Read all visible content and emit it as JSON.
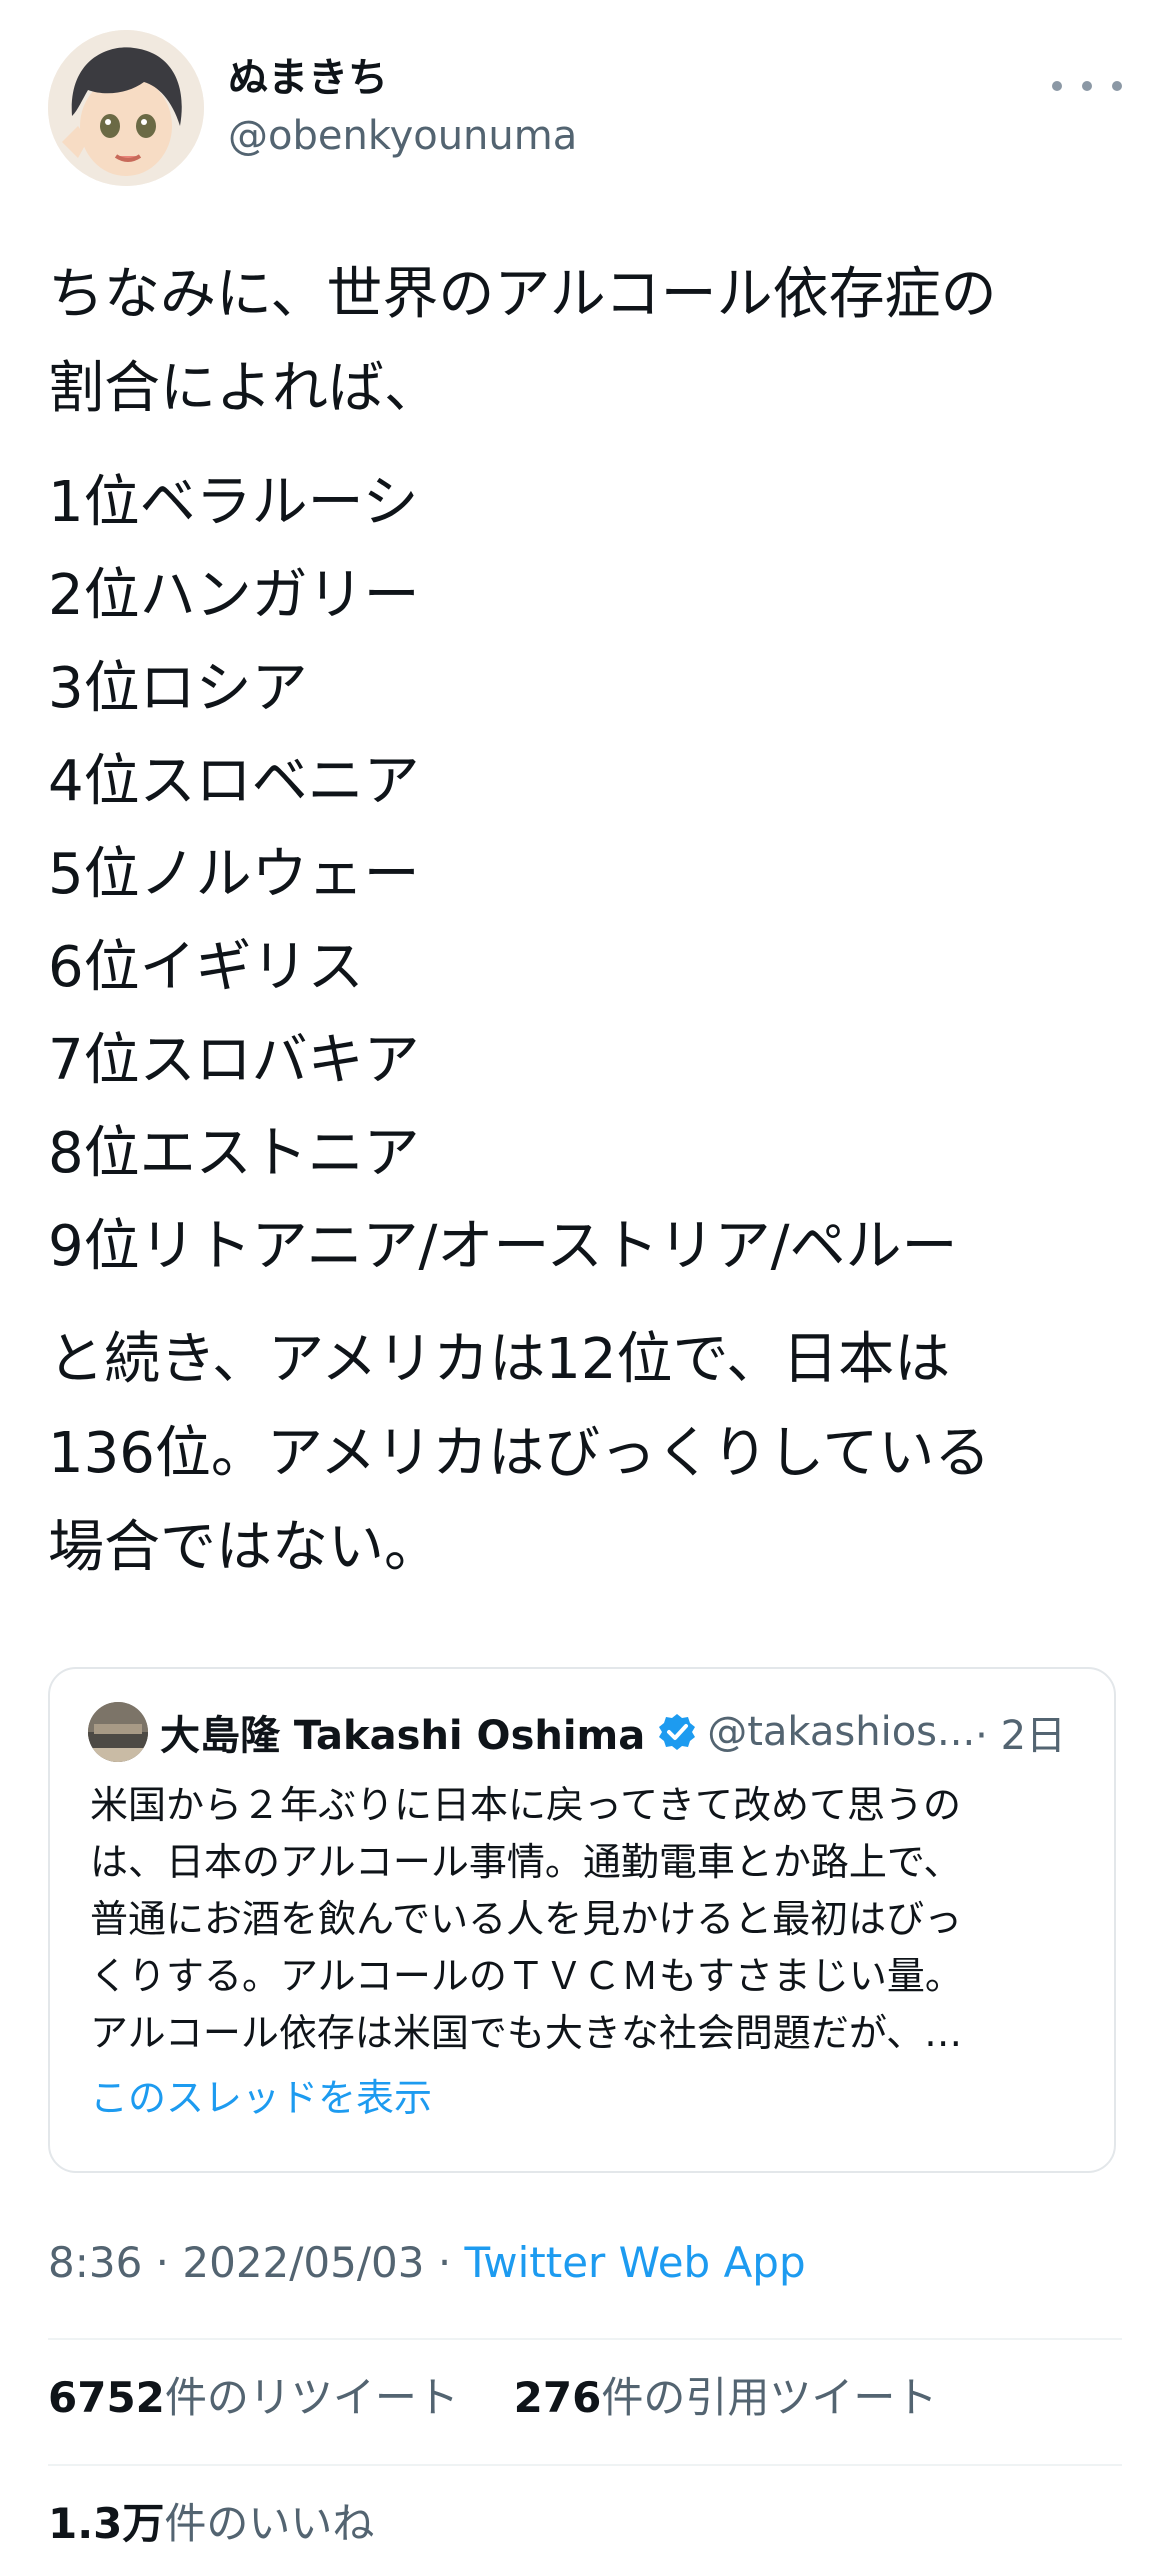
{
  "author": {
    "display_name": "ぬまきち",
    "handle": "@obenkyounuma"
  },
  "tweet": {
    "intro": "ちなみに、世界のアルコール依存症の\n割合によれば、",
    "ranks": [
      "1位ベラルーシ",
      "2位ハンガリー",
      "3位ロシア",
      "4位スロベニア",
      "5位ノルウェー",
      "6位イギリス",
      "7位スロバキア",
      "8位エストニア",
      "9位リトアニア/オーストリア/ペルー"
    ],
    "conclusion": "と続き、アメリカは12位で、日本は\n136位。アメリカはびっくりしている\n場合ではない。"
  },
  "quote": {
    "display_name": "大島隆 Takashi Oshima",
    "handle": "@takashios...",
    "time": "· 2日",
    "lines": [
      "米国から２年ぶりに日本に戻ってきて改めて思うの",
      "は、日本のアルコール事情。通勤電車とか路上で、",
      "普通にお酒を飲んでいる人を見かけると最初はびっ",
      "くりする。アルコールのＴＶＣＭもすさまじい量。",
      "アルコール依存は米国でも大きな社会問題だが、…"
    ],
    "show_thread": "このスレッドを表示"
  },
  "meta": {
    "time": "8:36",
    "sep1": " · ",
    "date": "2022/05/03",
    "sep2": " · ",
    "app": "Twitter Web App"
  },
  "stats": {
    "retweets_count": "6752",
    "retweets_label": "件のリツイート",
    "quotes_count": "276",
    "quotes_label": "件の引用ツイート",
    "likes_count": "1.3万",
    "likes_label": "件のいいね"
  },
  "colors": {
    "link": "#1d9bf0",
    "secondary_text": "#536471",
    "primary_text": "#0f1419"
  }
}
